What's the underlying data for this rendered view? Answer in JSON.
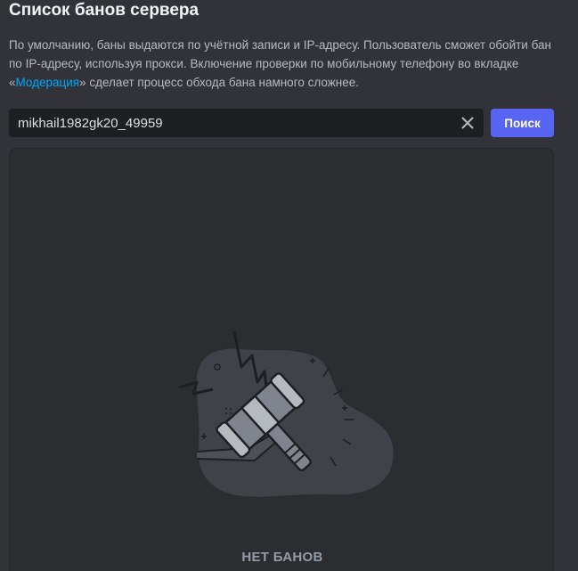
{
  "header": {
    "title": "Список банов сервера"
  },
  "description": {
    "text_before": "По умолчанию, баны выдаются по учётной записи и IP-адресу. Пользователь сможет обойти бан по IP-адресу, используя прокси. Включение проверки по мобильному телефону во вкладке «",
    "link_label": "Модерация",
    "text_after": "» сделает процесс обхода бана намного сложнее."
  },
  "search": {
    "value": "mikhail1982gk20_49959",
    "clear_icon": "close-icon",
    "button_label": "Поиск"
  },
  "bans": {
    "empty_label": "НЕТ БАНОВ",
    "empty_icon": "ban-hammer-icon"
  },
  "colors": {
    "background": "#313338",
    "panel": "#2b2d31",
    "input": "#1e1f22",
    "accent": "#5865f2",
    "link": "#00a8fc"
  }
}
